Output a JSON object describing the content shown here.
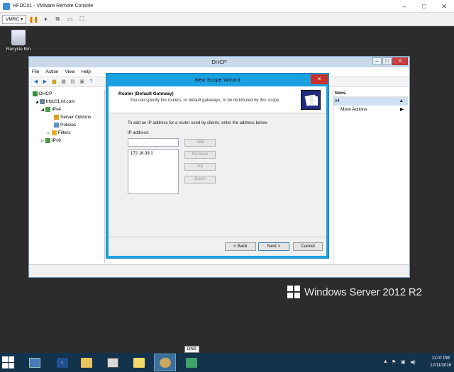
{
  "vmrc": {
    "window_title": "HFDC01 - VMware Remote Console",
    "menu_label": "VMRC",
    "minimize": "–",
    "maximize": "□",
    "close": "✕"
  },
  "desktop": {
    "recycle_bin_label": "Recycle Bin",
    "branding_text": "Windows Server 2012 R2"
  },
  "dhcp": {
    "title": "DHCP",
    "menu": [
      "File",
      "Action",
      "View",
      "Help"
    ],
    "tree": {
      "root": "DHCP",
      "server": "hfdc01.hf.com",
      "ipv4": "IPv4",
      "server_options": "Server Options",
      "policies": "Policies",
      "filters": "Filters",
      "ipv6": "IPv6"
    },
    "actions": {
      "header": "tions",
      "selected": "v4",
      "more_actions": "More Actions"
    }
  },
  "wizard": {
    "title": "New Scope Wizard",
    "close": "✕",
    "header_title": "Router (Default Gateway)",
    "header_desc": "You can specify the routers, or default gateways, to be distributed by this scope.",
    "instruction": "To add an IP address for a router used by clients, enter the address below.",
    "ip_label": "IP address:",
    "ip_input_value": ". . .",
    "router_list": [
      "172.18.39.1"
    ],
    "add_label": "Add",
    "remove_label": "Remove",
    "up_label": "Up",
    "down_label": "Down",
    "back_label": "< Back",
    "next_label": "Next >",
    "cancel_label": "Cancel"
  },
  "taskbar": {
    "tooltip": "DNS",
    "time": "11:07 PM",
    "date": "12/11/2016"
  }
}
